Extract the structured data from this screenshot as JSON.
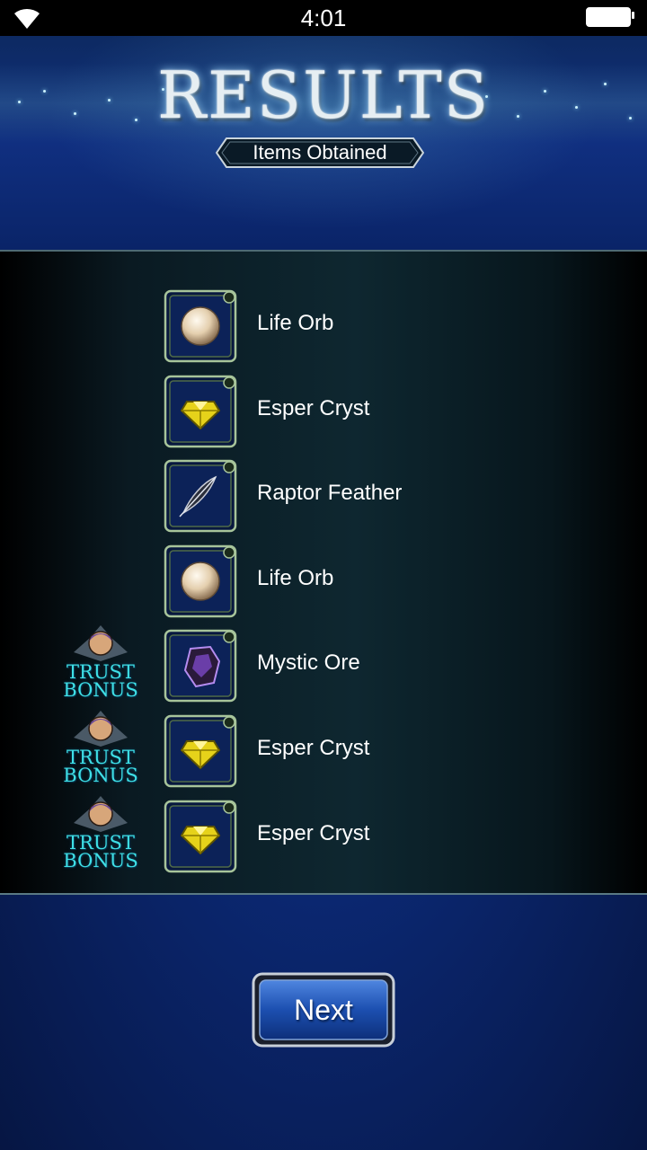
{
  "status_bar": {
    "time": "4:01",
    "wifi_icon": "wifi-icon",
    "battery_icon": "battery-icon"
  },
  "header": {
    "title": "RESULTS",
    "subtitle": "Items Obtained"
  },
  "items": [
    {
      "name": "Life Orb",
      "icon": "life-orb-icon",
      "trust_bonus": false
    },
    {
      "name": "Esper Cryst",
      "icon": "esper-cryst-icon",
      "trust_bonus": false
    },
    {
      "name": "Raptor Feather",
      "icon": "raptor-feather-icon",
      "trust_bonus": false
    },
    {
      "name": "Life Orb",
      "icon": "life-orb-icon",
      "trust_bonus": false
    },
    {
      "name": "Mystic Ore",
      "icon": "mystic-ore-icon",
      "trust_bonus": true
    },
    {
      "name": "Esper Cryst",
      "icon": "esper-cryst-icon",
      "trust_bonus": true
    },
    {
      "name": "Esper Cryst",
      "icon": "esper-cryst-icon",
      "trust_bonus": true
    }
  ],
  "trust_bonus_label": "TRUST\nBONUS",
  "next_button": {
    "label": "Next"
  },
  "colors": {
    "accent_cyan": "#3fe0e6",
    "panel_border": "#5a7a84",
    "background_blue": "#0b2770"
  }
}
